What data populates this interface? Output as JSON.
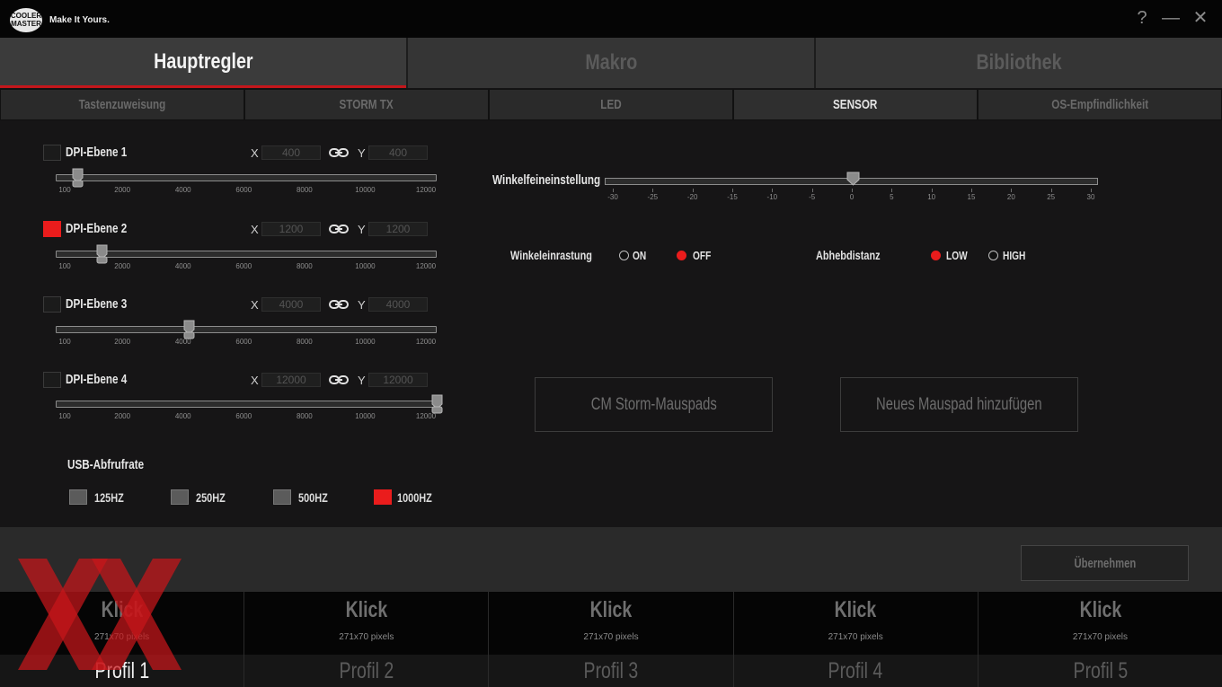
{
  "titlebar": {
    "logo_text": "COOLER MASTER",
    "slogan": "Make It Yours.",
    "help_glyph": "?",
    "minimize_glyph": "—",
    "close_glyph": "✕"
  },
  "main_tabs": [
    {
      "label": "Hauptregler",
      "active": true
    },
    {
      "label": "Makro",
      "active": false
    },
    {
      "label": "Bibliothek",
      "active": false
    }
  ],
  "sub_tabs": [
    {
      "label": "Tastenzuweisung",
      "active": false
    },
    {
      "label": "STORM TX",
      "active": false
    },
    {
      "label": "LED",
      "active": false
    },
    {
      "label": "SENSOR",
      "active": true
    },
    {
      "label": "OS-Empfindlichkeit",
      "active": false
    }
  ],
  "dpi": {
    "x_label": "X",
    "y_label": "Y",
    "tick_labels": [
      "100",
      "2000",
      "4000",
      "6000",
      "8000",
      "10000",
      "12000"
    ],
    "tick_values": [
      100,
      2000,
      4000,
      6000,
      8000,
      10000,
      12000
    ],
    "range": [
      100,
      12000
    ],
    "levels": [
      {
        "label": "DPI-Ebene 1",
        "checked": false,
        "x": "400",
        "y": "400",
        "value": 400
      },
      {
        "label": "DPI-Ebene 2",
        "checked": true,
        "x": "1200",
        "y": "1200",
        "value": 1200
      },
      {
        "label": "DPI-Ebene 3",
        "checked": false,
        "x": "4000",
        "y": "4000",
        "value": 4000
      },
      {
        "label": "DPI-Ebene 4",
        "checked": false,
        "x": "12000",
        "y": "12000",
        "value": 12000
      }
    ]
  },
  "usb": {
    "title": "USB-Abfrufrate",
    "options": [
      {
        "label": "125HZ",
        "selected": false
      },
      {
        "label": "250HZ",
        "selected": false
      },
      {
        "label": "500HZ",
        "selected": false
      },
      {
        "label": "1000HZ",
        "selected": true
      }
    ]
  },
  "angle": {
    "title": "Winkelfeineinstellung",
    "tick_labels": [
      "-30",
      "-25",
      "-20",
      "-15",
      "-10",
      "-5",
      "0",
      "5",
      "10",
      "15",
      "20",
      "25",
      "30"
    ],
    "range": [
      -30,
      30
    ],
    "value": 0
  },
  "snapping": {
    "title": "Winkeleinrastung",
    "on_label": "ON",
    "off_label": "OFF",
    "selected": "OFF"
  },
  "liftoff": {
    "title": "Abhebdistanz",
    "low_label": "LOW",
    "high_label": "HIGH",
    "selected": "LOW"
  },
  "buttons": {
    "mauspads": "CM Storm-Mauspads",
    "add_mauspad": "Neues Mauspad hinzufügen",
    "apply": "Übernehmen"
  },
  "profiles": [
    {
      "klick": "Klick",
      "pixels": "271x70 pixels",
      "name": "Profil 1",
      "active": true
    },
    {
      "klick": "Klick",
      "pixels": "271x70 pixels",
      "name": "Profil 2",
      "active": false
    },
    {
      "klick": "Klick",
      "pixels": "271x70 pixels",
      "name": "Profil 3",
      "active": false
    },
    {
      "klick": "Klick",
      "pixels": "271x70 pixels",
      "name": "Profil 4",
      "active": false
    },
    {
      "klick": "Klick",
      "pixels": "271x70 pixels",
      "name": "Profil 5",
      "active": false
    }
  ],
  "colors": {
    "accent": "#ea1c1c",
    "tab_underline": "#c4161b",
    "background": "#161516"
  }
}
